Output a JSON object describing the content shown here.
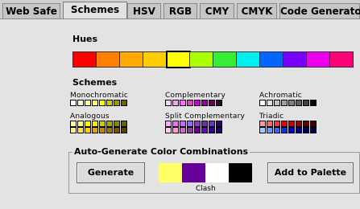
{
  "tabs": [
    {
      "label": "Web Safe",
      "active": false
    },
    {
      "label": "Schemes",
      "active": true
    },
    {
      "label": "HSV",
      "active": false
    },
    {
      "label": "RGB",
      "active": false
    },
    {
      "label": "CMY",
      "active": false
    },
    {
      "label": "CMYK",
      "active": false
    },
    {
      "label": "Code Generator",
      "active": false
    }
  ],
  "hues": {
    "title": "Hues",
    "colors": [
      "#ff0000",
      "#ff7f00",
      "#ffaa00",
      "#ffcc00",
      "#ffff00",
      "#aaff00",
      "#33ee33",
      "#00eeee",
      "#0066ff",
      "#7700ff",
      "#ee00ee",
      "#ff0077"
    ],
    "selected_index": 4
  },
  "schemes": {
    "title": "Schemes",
    "items": [
      {
        "name": "Monochromatic",
        "rows": [
          [
            "#ffffff",
            "#ffffcc",
            "#ffff99",
            "#ffff66",
            "#ffff00",
            "#cccc00",
            "#999900",
            "#666600"
          ]
        ]
      },
      {
        "name": "Complementary",
        "rows": [
          [
            "#ffccff",
            "#ff99ff",
            "#ff66ff",
            "#ff33cc",
            "#cc00cc",
            "#990099",
            "#660066",
            "#330033"
          ]
        ]
      },
      {
        "name": "Achromatic",
        "rows": [
          [
            "#ffffff",
            "#e0e0e0",
            "#c0c0c0",
            "#a0a0a0",
            "#808080",
            "#606060",
            "#404040",
            "#000000"
          ]
        ]
      },
      {
        "name": "Analogous",
        "rows": [
          [
            "#ffff99",
            "#ffff66",
            "#ffff00",
            "#eeee00",
            "#cccc00",
            "#aaaa00",
            "#888800",
            "#666600"
          ],
          [
            "#ffee88",
            "#ffdd44",
            "#ffcc00",
            "#ddaa00",
            "#bb8800",
            "#997700",
            "#775500",
            "#554400"
          ]
        ]
      },
      {
        "name": "Split Complementary",
        "rows": [
          [
            "#ffaaff",
            "#ff66ff",
            "#cc66ff",
            "#9966ff",
            "#9933cc",
            "#663399",
            "#6633cc",
            "#330066"
          ],
          [
            "#ffccee",
            "#ff99dd",
            "#cc66cc",
            "#9933aa",
            "#660099",
            "#6600cc",
            "#330099",
            "#220066"
          ]
        ]
      },
      {
        "name": "Triadic",
        "rows": [
          [
            "#ff9999",
            "#ff6666",
            "#ff3333",
            "#ee0000",
            "#cc0000",
            "#990000",
            "#660000",
            "#440000"
          ],
          [
            "#99ccff",
            "#6699ff",
            "#3366ff",
            "#0033ee",
            "#0000cc",
            "#000099",
            "#000066",
            "#000044"
          ]
        ]
      }
    ]
  },
  "auto_generate": {
    "title": "Auto-Generate Color Combinations",
    "generate_label": "Generate",
    "add_label": "Add to Palette",
    "combo_colors": [
      "#ffff66",
      "#660099",
      "#ffffff",
      "#000000"
    ],
    "combo_name": "Clash"
  }
}
